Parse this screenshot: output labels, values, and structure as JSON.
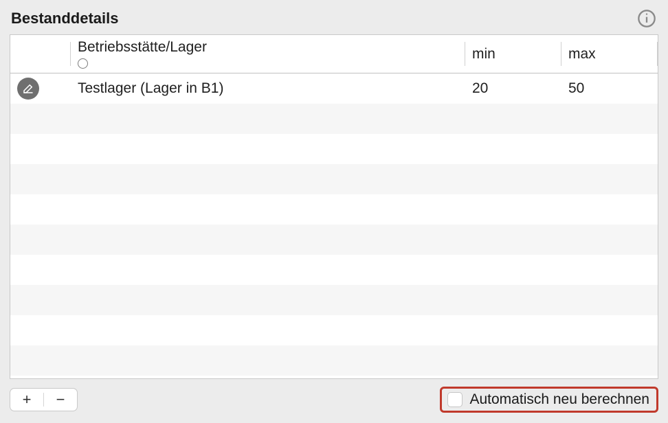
{
  "panel": {
    "title": "Bestanddetails"
  },
  "table": {
    "headers": {
      "name": "Betriebsstätte/Lager",
      "min": "min",
      "max": "max"
    },
    "rows": [
      {
        "name": "Testlager (Lager in B1)",
        "min": "20",
        "max": "50"
      }
    ]
  },
  "footer": {
    "add_label": "+",
    "remove_label": "−",
    "auto_recalculate_label": "Automatisch neu berechnen"
  }
}
